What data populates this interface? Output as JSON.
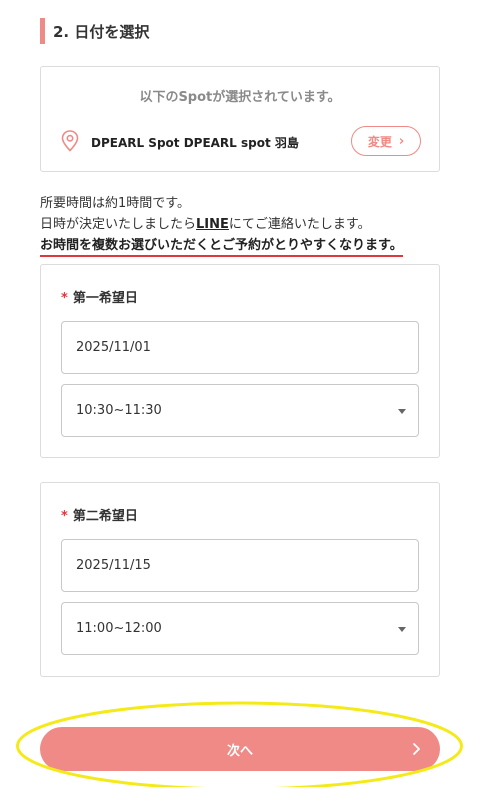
{
  "section": {
    "title": "2. 日付を選択"
  },
  "spot": {
    "heading": "以下のSpotが選択されています。",
    "name": "DPEARL Spot DPEARL spot 羽島",
    "change_label": "変更",
    "icon": "location-pin-icon"
  },
  "info": {
    "line1": "所要時間は約1時間です。",
    "line2_prefix": "日時が決定いたしましたら",
    "line2_link": "LINE",
    "line2_suffix": "にてご連絡いたします。",
    "line3": "お時間を複数お選びいただくとご予約がとりやすくなります。"
  },
  "preferences": [
    {
      "required_mark": "*",
      "label": "第一希望日",
      "date": "2025/11/01",
      "time": "10:30~11:30"
    },
    {
      "required_mark": "*",
      "label": "第二希望日",
      "date": "2025/11/15",
      "time": "11:00~12:00"
    }
  ],
  "next_button": {
    "label": "次へ"
  },
  "colors": {
    "accent": "#ef8a86",
    "required": "#e0373a",
    "annotation": "#f5ea19"
  }
}
